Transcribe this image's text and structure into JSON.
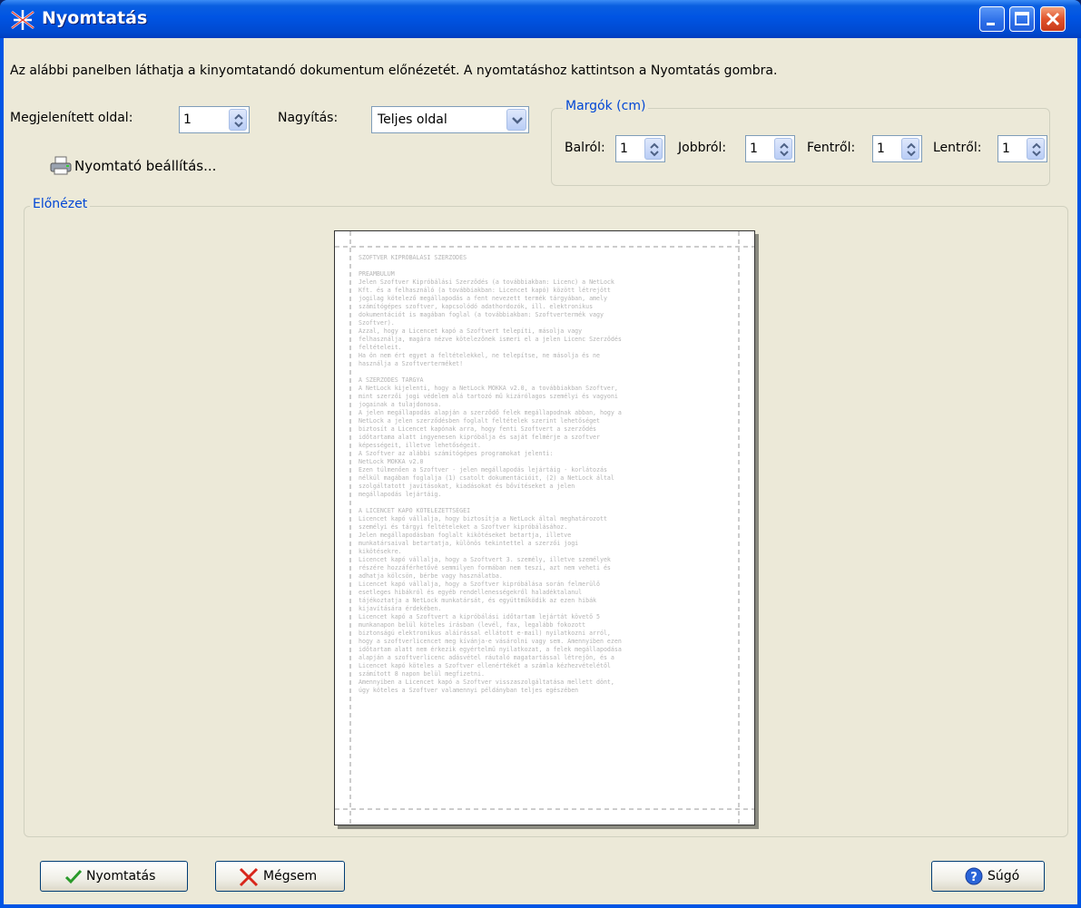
{
  "window": {
    "title": "Nyomtatás"
  },
  "instruction": "Az alábbi panelben láthatja a kinyomtatandó dokumentum előnézetét. A nyomtatáshoz kattintson a Nyomtatás gombra.",
  "controls": {
    "page_label": "Megjelenített oldal:",
    "page_value": "1",
    "zoom_label": "Nagyítás:",
    "zoom_value": "Teljes oldal",
    "printer_settings": "Nyomtató beállítás..."
  },
  "margins": {
    "title": "Margók (cm)",
    "left_label": "Balról:",
    "left_value": "1",
    "right_label": "Jobbról:",
    "right_value": "1",
    "top_label": "Fentről:",
    "top_value": "1",
    "bottom_label": "Lentről:",
    "bottom_value": "1"
  },
  "preview": {
    "title": "Előnézet",
    "lines": [
      "SZOFTVER KIPRÓBÁLÁSI SZERZŐDÉS",
      "",
      "PREAMBULUM",
      "Jelen Szoftver Kipróbálási Szerződés (a továbbiakban: Licenc) a NetLock",
      "Kft. és a felhasználó (a továbbiakban: Licencet kapó) között létrejött",
      "jogilag kötelező megállapodás a fent nevezett termék tárgyában, amely",
      "számítógépes szoftver, kapcsolódó adathordozók, ill. elektronikus",
      "dokumentációt is magában foglal (a továbbiakban: Szoftvertermék vagy",
      "Szoftver).",
      "Azzal, hogy a Licencet kapó a Szoftvert telepíti, másolja vagy",
      "felhasználja, magára nézve kötelezőnek ismeri el a jelen Licenc Szerződés",
      "feltételeit.",
      "Ha ön nem ért egyet a feltételekkel, ne telepítse, ne másolja és ne",
      "használja a Szoftverterméket!",
      "",
      "A SZERZŐDÉS TÁRGYA",
      "A NetLock kijelenti, hogy a NetLock MOKKA v2.0, a továbbiakban Szoftver,",
      "mint szerzői jogi védelem alá tartozó mű kizárólagos személyi és vagyoni",
      "jogainak a tulajdonosa.",
      "A jelen megállapodás alapján a szerződő felek megállapodnak abban, hogy a",
      "NetLock a jelen szerződésben foglalt feltételek szerint lehetőséget",
      "biztosít a Licencet kapónak arra, hogy fenti Szoftvert a szerződés",
      "időtartama alatt ingyenesen kipróbálja és saját felmérje a szoftver",
      "képességeit, illetve lehetőségeit.",
      "A Szoftver az alábbi számítógépes programokat jelenti:",
      "NetLock MOKKA v2.0",
      "Ezen túlmenően a Szoftver - jelen megállapodás lejártáig - korlátozás",
      "nélkül magában foglalja (1) csatolt dokumentációit, (2) a NetLock által",
      "szolgáltatott javításokat, kiadásokat és bővítéseket a jelen",
      "megállapodás lejártáig.",
      "",
      "A LICENCET KAPÓ KÖTELEZETTSÉGEI",
      "Licencet kapó vállalja, hogy biztosítja a NetLock által meghatározott",
      "személyi és tárgyi feltételeket a Szoftver kipróbálásához.",
      "Jelen megállapodásban foglalt kikötéseket betartja, illetve",
      "munkatársaival betartatja, különös tekintettel a szerzői jogi",
      "kikötésekre.",
      "Licencet kapó vállalja, hogy a Szoftvert 3. személy, illetve személyek",
      "részére hozzáférhetővé semmilyen formában nem teszi, azt nem veheti és",
      "adhatja kölcsön, bérbe vagy használatba.",
      "Licencet kapó vállalja, hogy a Szoftver kipróbálása során felmerülő",
      "esetleges hibákról és egyéb rendellenességekről haladéktalanul",
      "tájékoztatja a NetLock munkatársát, és együttműködik az ezen hibák",
      "kijavítására érdekében.",
      "Licencet kapó a Szoftvert a kipróbálási időtartam lejártát követő 5",
      "munkanapon belül köteles írásban (levél, fax, legalább fokozott",
      "biztonságú elektronikus aláírással ellátott e-mail) nyilatkozni arról,",
      "hogy a szoftverlicencet meg kívánja-e vásárolni vagy sem. Amennyiben ezen",
      "időtartam alatt nem érkezik egyértelmű nyilatkozat, a felek megállapodása",
      "alapján a szoftverlicenc adásvétel ráutaló magatartással létrejön, és a",
      "Licencet kapó köteles a Szoftver ellenértékét a számla kézhezvételétől",
      "számított 8 napon belül megfizetni.",
      "Amennyiben a Licencet kapó a Szoftver visszaszolgáltatása mellett dönt,",
      "úgy köteles a Szoftver valamennyi példányban teljes egészében"
    ]
  },
  "buttons": {
    "print": "Nyomtatás",
    "cancel": "Mégsem",
    "help": "Súgó"
  },
  "colors": {
    "titlebar": "#0054e3",
    "dialog_bg": "#ece9d8",
    "group_title": "#0046d5",
    "close_button": "#e0532c"
  }
}
